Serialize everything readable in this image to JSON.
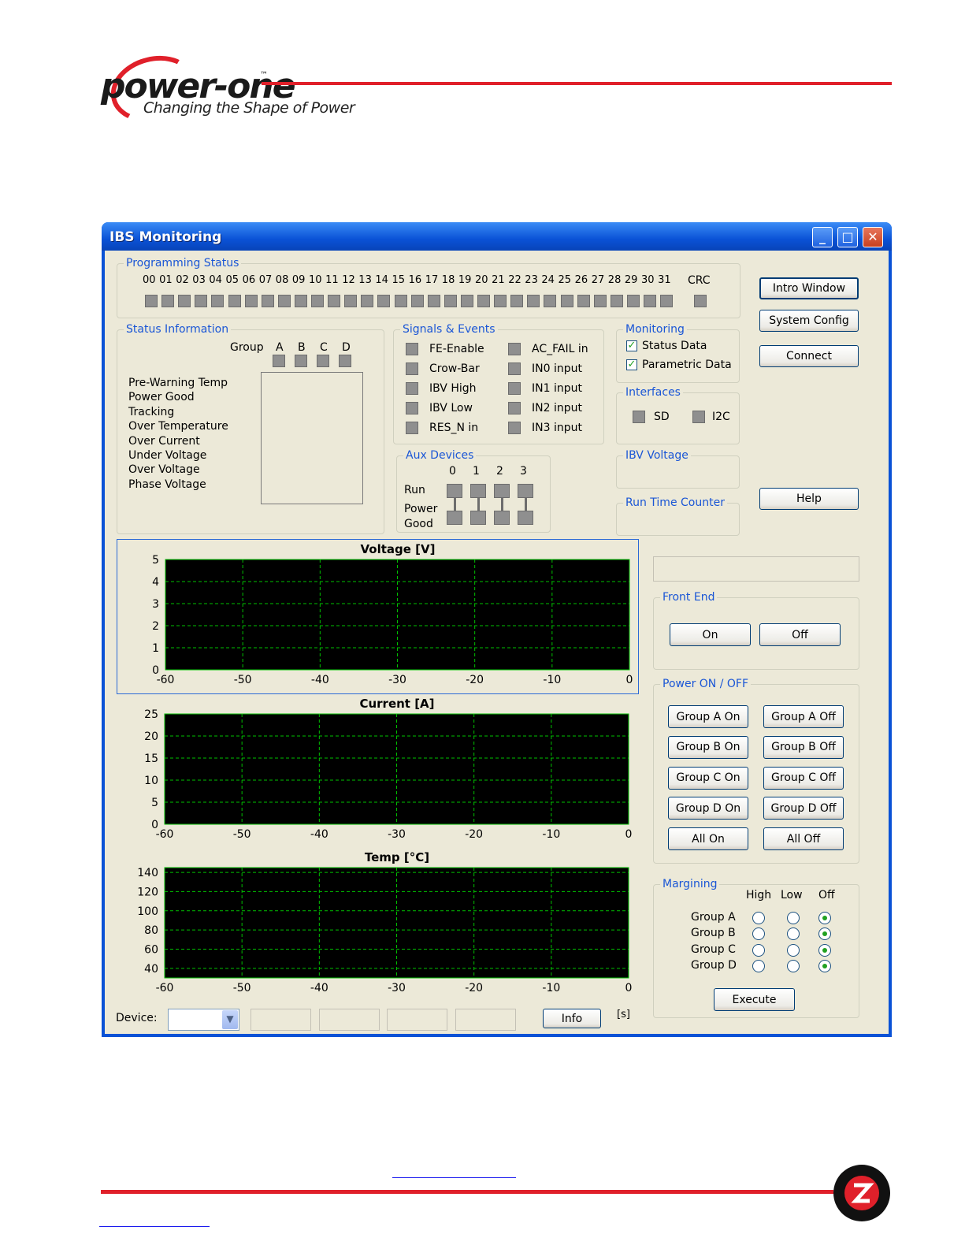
{
  "brand": {
    "name": "power-one",
    "tm": "™",
    "tagline": "Changing the Shape of Power"
  },
  "window": {
    "title": "IBS Monitoring",
    "minimize_glyph": "_",
    "maximize_glyph": "□",
    "close_glyph": "✕"
  },
  "programming_status": {
    "title": "Programming Status",
    "channels": [
      "00",
      "01",
      "02",
      "03",
      "04",
      "05",
      "06",
      "07",
      "08",
      "09",
      "10",
      "11",
      "12",
      "13",
      "14",
      "15",
      "16",
      "17",
      "18",
      "19",
      "20",
      "21",
      "22",
      "23",
      "24",
      "25",
      "26",
      "27",
      "28",
      "29",
      "30",
      "31"
    ],
    "crc_label": "CRC"
  },
  "status_info": {
    "title": "Status Information",
    "group_label": "Group",
    "groups": [
      "A",
      "B",
      "C",
      "D"
    ],
    "items": [
      "Pre-Warning Temp",
      "Power Good",
      "Tracking",
      "Over Temperature",
      "Over Current",
      "Under Voltage",
      "Over Voltage",
      "Phase Voltage"
    ]
  },
  "signals": {
    "title": "Signals & Events",
    "left": [
      "FE-Enable",
      "Crow-Bar",
      "IBV High",
      "IBV Low",
      "RES_N in"
    ],
    "right": [
      "AC_FAIL in",
      "IN0 input",
      "IN1 input",
      "IN2 input",
      "IN3 input"
    ]
  },
  "aux": {
    "title": "Aux Devices",
    "cols": [
      "0",
      "1",
      "2",
      "3"
    ],
    "run_label": "Run",
    "power_label": "Power",
    "good_label": "Good"
  },
  "monitoring": {
    "title": "Monitoring",
    "status_data": "Status Data",
    "parametric_data": "Parametric Data",
    "status_checked": true,
    "parametric_checked": true
  },
  "interfaces": {
    "title": "Interfaces",
    "sd": "SD",
    "i2c": "I2C"
  },
  "ibv_voltage": {
    "title": "IBV Voltage"
  },
  "run_time": {
    "title": "Run Time Counter"
  },
  "buttons": {
    "intro": "Intro Window",
    "system_config": "System Config",
    "connect": "Connect",
    "help": "Help"
  },
  "front_end": {
    "title": "Front End",
    "on": "On",
    "off": "Off"
  },
  "power": {
    "title": "Power ON / OFF",
    "rows": [
      [
        "Group A On",
        "Group A Off"
      ],
      [
        "Group B On",
        "Group B Off"
      ],
      [
        "Group C On",
        "Group C Off"
      ],
      [
        "Group D On",
        "Group D Off"
      ],
      [
        "All On",
        "All Off"
      ]
    ]
  },
  "margining": {
    "title": "Margining",
    "cols": [
      "High",
      "Low",
      "Off"
    ],
    "groups": [
      "Group A",
      "Group B",
      "Group C",
      "Group D"
    ],
    "selected": "Off",
    "execute": "Execute"
  },
  "bottom": {
    "device_label": "Device:",
    "info": "Info",
    "unit": "[s]"
  },
  "colors": {
    "accent_red": "#e0202a",
    "xp_blue": "#0a52d6",
    "grid_green": "#00c000",
    "plot_bg": "#000000"
  },
  "chart_data": [
    {
      "type": "line",
      "title": "Voltage [V]",
      "xlabel": "",
      "ylabel": "",
      "x_ticks": [
        -60,
        -50,
        -40,
        -30,
        -20,
        -10,
        0
      ],
      "y_ticks": [
        0,
        1,
        2,
        3,
        4,
        5
      ],
      "xlim": [
        -60,
        0
      ],
      "ylim": [
        0,
        5
      ],
      "grid": true,
      "series": []
    },
    {
      "type": "line",
      "title": "Current [A]",
      "xlabel": "",
      "ylabel": "",
      "x_ticks": [
        -60,
        -50,
        -40,
        -30,
        -20,
        -10,
        0
      ],
      "y_ticks": [
        0,
        5,
        10,
        15,
        20,
        25
      ],
      "xlim": [
        -60,
        0
      ],
      "ylim": [
        0,
        25
      ],
      "grid": true,
      "series": []
    },
    {
      "type": "line",
      "title": "Temp [°C]",
      "xlabel": "",
      "ylabel": "",
      "x_ticks": [
        -60,
        -50,
        -40,
        -30,
        -20,
        -10,
        0
      ],
      "y_ticks": [
        40,
        60,
        80,
        100,
        120,
        140
      ],
      "xlim": [
        -60,
        0
      ],
      "ylim": [
        30,
        145
      ],
      "grid": true,
      "series": []
    }
  ]
}
